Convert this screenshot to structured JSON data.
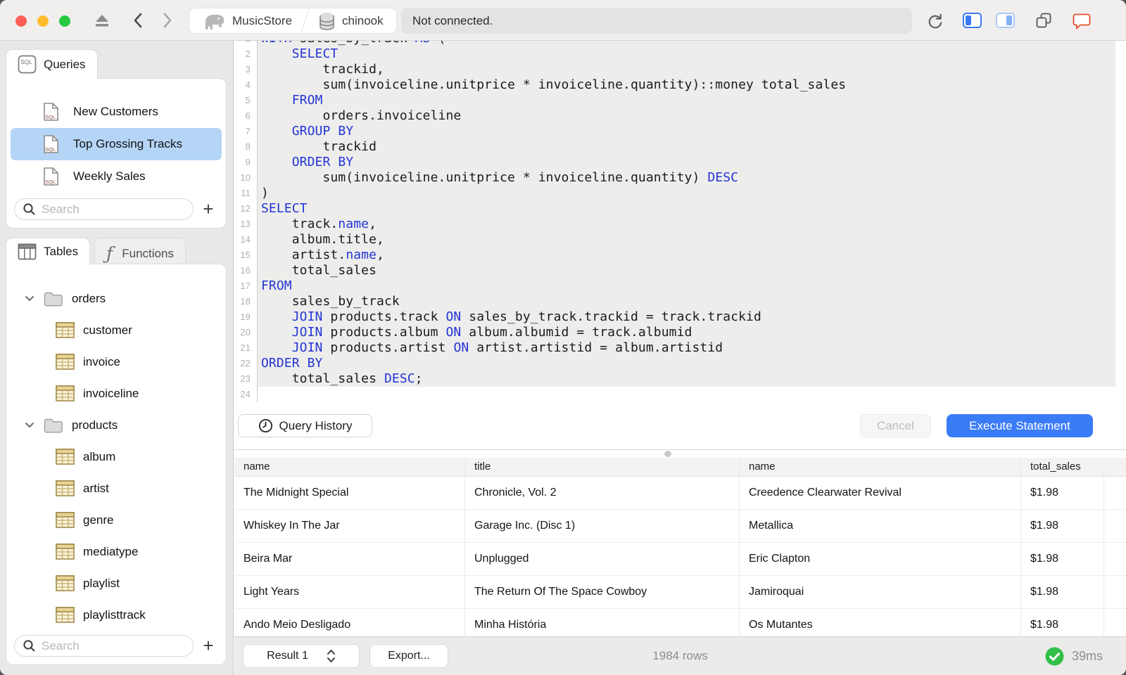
{
  "window": {
    "traffic_lights": [
      "#ff5f57",
      "#febc2e",
      "#28c840"
    ],
    "toolbar": {
      "breadcrumb": {
        "server_label": "MusicStore",
        "database_label": "chinook"
      },
      "status": "Not connected."
    }
  },
  "colors": {
    "accent_blue": "#3a7bf6",
    "selection_blue": "#b4d5f6",
    "keyword_blue": "#2435d5",
    "success_green": "#32bf47",
    "chat_bubble_orange": "#e2502a",
    "statement_highlight": "#ededec"
  },
  "icons": {
    "elephant-icon": "postgres elephant glyph",
    "database-icon": "cylinder",
    "eject-icon": "triangle over bar",
    "back-icon": "chevron-left",
    "forward-icon": "chevron-right",
    "reload-icon": "circular arrow",
    "sidebar-left-icon": "panel with left bar",
    "sidebar-right-icon": "panel with right bar",
    "windows-icon": "two overlapping squares",
    "chat-icon": "speech bubble",
    "search-icon": "magnifier",
    "sql-file-icon": "document with SQL label",
    "folder-icon": "folder",
    "table-icon": "grid with header",
    "functions-icon": "florin f",
    "clock-icon": "clock face",
    "stepper-icon": "up-down chevrons",
    "check-icon": "checkmark in circle",
    "plus-icon": "+"
  },
  "sidebar": {
    "queries": {
      "tab_label": "Queries",
      "items": [
        {
          "label": "New Customers",
          "selected": false
        },
        {
          "label": "Top Grossing Tracks",
          "selected": true
        },
        {
          "label": "Weekly Sales",
          "selected": false
        }
      ],
      "search_placeholder": "Search"
    },
    "schema_browser": {
      "tabs": [
        {
          "label": "Tables",
          "active": true
        },
        {
          "label": "Functions",
          "active": false
        }
      ],
      "tree": [
        {
          "type": "schema",
          "label": "orders",
          "expanded": true
        },
        {
          "type": "table",
          "label": "customer"
        },
        {
          "type": "table",
          "label": "invoice"
        },
        {
          "type": "table",
          "label": "invoiceline"
        },
        {
          "type": "schema",
          "label": "products",
          "expanded": true
        },
        {
          "type": "table",
          "label": "album"
        },
        {
          "type": "table",
          "label": "artist"
        },
        {
          "type": "table",
          "label": "genre"
        },
        {
          "type": "table",
          "label": "mediatype"
        },
        {
          "type": "table",
          "label": "playlist"
        },
        {
          "type": "table",
          "label": "playlisttrack"
        }
      ],
      "search_placeholder": "Search"
    }
  },
  "editor": {
    "lines": [
      {
        "hl": true,
        "tokens": [
          [
            "kw",
            "WITH"
          ],
          [
            "t",
            " sales_by_track "
          ],
          [
            "kw",
            "AS"
          ],
          [
            "t",
            " ("
          ]
        ]
      },
      {
        "hl": true,
        "tokens": [
          [
            "t",
            "    "
          ],
          [
            "kw",
            "SELECT"
          ]
        ]
      },
      {
        "hl": true,
        "tokens": [
          [
            "t",
            "        trackid,"
          ]
        ]
      },
      {
        "hl": true,
        "tokens": [
          [
            "t",
            "        sum(invoiceline.unitprice * invoiceline.quantity)::money total_sales"
          ]
        ]
      },
      {
        "hl": true,
        "tokens": [
          [
            "t",
            "    "
          ],
          [
            "kw",
            "FROM"
          ]
        ]
      },
      {
        "hl": true,
        "tokens": [
          [
            "t",
            "        orders.invoiceline"
          ]
        ]
      },
      {
        "hl": true,
        "tokens": [
          [
            "t",
            "    "
          ],
          [
            "kw",
            "GROUP BY"
          ]
        ]
      },
      {
        "hl": true,
        "tokens": [
          [
            "t",
            "        trackid"
          ]
        ]
      },
      {
        "hl": true,
        "tokens": [
          [
            "t",
            "    "
          ],
          [
            "kw",
            "ORDER BY"
          ]
        ]
      },
      {
        "hl": true,
        "tokens": [
          [
            "t",
            "        sum(invoiceline.unitprice * invoiceline.quantity) "
          ],
          [
            "kw",
            "DESC"
          ]
        ]
      },
      {
        "hl": true,
        "tokens": [
          [
            "t",
            ")"
          ]
        ]
      },
      {
        "hl": true,
        "tokens": [
          [
            "kw",
            "SELECT"
          ]
        ]
      },
      {
        "hl": true,
        "tokens": [
          [
            "t",
            "    track."
          ],
          [
            "kw",
            "name"
          ],
          [
            "t",
            ","
          ]
        ]
      },
      {
        "hl": true,
        "tokens": [
          [
            "t",
            "    album.title,"
          ]
        ]
      },
      {
        "hl": true,
        "tokens": [
          [
            "t",
            "    artist."
          ],
          [
            "kw",
            "name"
          ],
          [
            "t",
            ","
          ]
        ]
      },
      {
        "hl": true,
        "tokens": [
          [
            "t",
            "    total_sales"
          ]
        ]
      },
      {
        "hl": true,
        "tokens": [
          [
            "kw",
            "FROM"
          ]
        ]
      },
      {
        "hl": true,
        "tokens": [
          [
            "t",
            "    sales_by_track"
          ]
        ]
      },
      {
        "hl": true,
        "tokens": [
          [
            "t",
            "    "
          ],
          [
            "kw",
            "JOIN"
          ],
          [
            "t",
            " products.track "
          ],
          [
            "kw",
            "ON"
          ],
          [
            "t",
            " sales_by_track.trackid = track.trackid"
          ]
        ]
      },
      {
        "hl": true,
        "tokens": [
          [
            "t",
            "    "
          ],
          [
            "kw",
            "JOIN"
          ],
          [
            "t",
            " products.album "
          ],
          [
            "kw",
            "ON"
          ],
          [
            "t",
            " album.albumid = track.albumid"
          ]
        ]
      },
      {
        "hl": true,
        "tokens": [
          [
            "t",
            "    "
          ],
          [
            "kw",
            "JOIN"
          ],
          [
            "t",
            " products.artist "
          ],
          [
            "kw",
            "ON"
          ],
          [
            "t",
            " artist.artistid = album.artistid"
          ]
        ]
      },
      {
        "hl": true,
        "tokens": [
          [
            "kw",
            "ORDER BY"
          ]
        ]
      },
      {
        "hl": true,
        "tokens": [
          [
            "t",
            "    total_sales "
          ],
          [
            "kw",
            "DESC"
          ],
          [
            "t",
            ";"
          ]
        ]
      },
      {
        "hl": false,
        "tokens": []
      }
    ]
  },
  "actions": {
    "query_history_label": "Query History",
    "cancel_label": "Cancel",
    "execute_label": "Execute Statement"
  },
  "results": {
    "columns": [
      "name",
      "title",
      "name",
      "total_sales",
      ""
    ],
    "rows": [
      [
        "The Midnight Special",
        "Chronicle, Vol. 2",
        "Creedence Clearwater Revival",
        "$1.98",
        ""
      ],
      [
        "Whiskey In The Jar",
        "Garage Inc. (Disc 1)",
        "Metallica",
        "$1.98",
        ""
      ],
      [
        "Beira Mar",
        "Unplugged",
        "Eric Clapton",
        "$1.98",
        ""
      ],
      [
        "Light Years",
        "The Return Of The Space Cowboy",
        "Jamiroquai",
        "$1.98",
        ""
      ],
      [
        "Ando Meio Desligado",
        "Minha História",
        "Os Mutantes",
        "$1.98",
        ""
      ]
    ]
  },
  "footer": {
    "result_selector_label": "Result 1",
    "export_label": "Export...",
    "row_count": "1984 rows",
    "duration": "39ms"
  }
}
